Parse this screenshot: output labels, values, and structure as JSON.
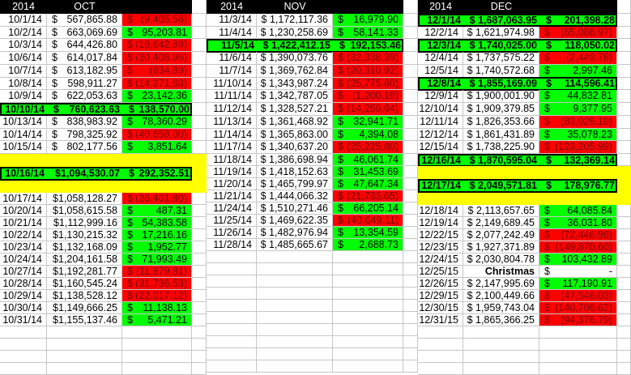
{
  "blocks": [
    {
      "header": {
        "year": "2014",
        "month": "OCT"
      },
      "rows": [
        {
          "date": "10/1/14",
          "amount_symbol": "$",
          "amount": "567,865.88",
          "change_symbol": "$",
          "change": "(9,405.56)",
          "sign": "neg"
        },
        {
          "date": "10/2/14",
          "amount_symbol": "$",
          "amount": "663,069.69",
          "change_symbol": "$",
          "change": "95,203.81",
          "sign": "pos"
        },
        {
          "date": "10/3/14",
          "amount_symbol": "$",
          "amount": "644,426.80",
          "change_symbol": "$",
          "change": "(18,642.89)",
          "sign": "neg"
        },
        {
          "date": "10/6/14",
          "amount_symbol": "$",
          "amount": "614,017.84",
          "change_symbol": "$",
          "change": "(30,408.96)",
          "sign": "neg"
        },
        {
          "date": "10/7/14",
          "amount_symbol": "$",
          "amount": "613,182.95",
          "change_symbol": "$",
          "change": "(834.89)",
          "sign": "neg"
        },
        {
          "date": "10/8/14",
          "amount_symbol": "$",
          "amount": "598,911.27",
          "change_symbol": "$",
          "change": "(14,271.68)",
          "sign": "neg"
        },
        {
          "date": "10/9/14",
          "amount_symbol": "$",
          "amount": "622,053.63",
          "change_symbol": "$",
          "change": "23,142.36",
          "sign": "pos"
        },
        {
          "date": "10/10/14",
          "amount_symbol": "$",
          "amount": "760,623.63",
          "change_symbol": "$",
          "change": "138,570.00",
          "sign": "pos",
          "emphasis": "box"
        },
        {
          "date": "10/13/14",
          "amount_symbol": "$",
          "amount": "838,983.92",
          "change_symbol": "$",
          "change": "78,360.29",
          "sign": "pos"
        },
        {
          "date": "10/14/14",
          "amount_symbol": "$",
          "amount": "798,325.92",
          "change_symbol": "$",
          "change": "(40,658.00)",
          "sign": "neg"
        },
        {
          "date": "10/15/14",
          "amount_symbol": "$",
          "amount": "802,177.56",
          "change_symbol": "$",
          "change": "3,851.64",
          "sign": "pos"
        },
        {
          "date": "10/16/14",
          "amount": "$1,094,530.07",
          "change_symbol": "$",
          "change": "292,352.51",
          "sign": "pos",
          "emphasis": "band"
        },
        {
          "date": "10/17/14",
          "amount": "$1,058,128.27",
          "change_symbol": "$",
          "change": "(36,401.80)",
          "sign": "neg"
        },
        {
          "date": "10/20/14",
          "amount": "$1,058,615.58",
          "change_symbol": "$",
          "change": "487.31",
          "sign": "pos"
        },
        {
          "date": "10/21/14",
          "amount": "$1,112,999.16",
          "change_symbol": "$",
          "change": "54,383.58",
          "sign": "pos"
        },
        {
          "date": "10/22/14",
          "amount": "$1,130,215.32",
          "change_symbol": "$",
          "change": "17,216.16",
          "sign": "pos"
        },
        {
          "date": "10/23/14",
          "amount": "$1,132,168.09",
          "change_symbol": "$",
          "change": "1,952.77",
          "sign": "pos"
        },
        {
          "date": "10/24/14",
          "amount": "$1,204,161.58",
          "change_symbol": "$",
          "change": "71,993.49",
          "sign": "pos"
        },
        {
          "date": "10/27/14",
          "amount": "$1,192,281.77",
          "change_symbol": "$",
          "change": "(11,879.81)",
          "sign": "neg"
        },
        {
          "date": "10/28/14",
          "amount": "$1,160,545.24",
          "change_symbol": "$",
          "change": "(31,736.53)",
          "sign": "neg"
        },
        {
          "date": "10/29/14",
          "amount": "$1,138,528.12",
          "change_symbol": "$",
          "change": "(22,017.12)",
          "sign": "neg"
        },
        {
          "date": "10/30/14",
          "amount": "$1,149,666.25",
          "change_symbol": "$",
          "change": "11,138.13",
          "sign": "pos"
        },
        {
          "date": "10/31/14",
          "amount": "$1,155,137.46",
          "change_symbol": "$",
          "change": "5,471.21",
          "sign": "pos"
        }
      ]
    },
    {
      "header": {
        "year": "2014",
        "month": "NOV"
      },
      "rows": [
        {
          "date": "11/3/14",
          "amount": "$ 1,172,117.36",
          "change_symbol": "$",
          "change": "16,979.90",
          "sign": "pos"
        },
        {
          "date": "11/4/14",
          "amount": "$ 1,230,258.69",
          "change_symbol": "$",
          "change": "58,141.33",
          "sign": "pos"
        },
        {
          "date": "11/5/14",
          "amount": "$ 1,422,412.15",
          "change_symbol": "$",
          "change": "192,153.46",
          "sign": "pos",
          "emphasis": "box"
        },
        {
          "date": "11/6/14",
          "amount": "$ 1,390,073.76",
          "change_symbol": "$",
          "change": "(32,338.39)",
          "sign": "neg"
        },
        {
          "date": "11/7/14",
          "amount": "$ 1,369,762.84",
          "change_symbol": "$",
          "change": "(20,310.92)",
          "sign": "neg"
        },
        {
          "date": "11/10/14",
          "amount": "$ 1,343,987.24",
          "change_symbol": "$",
          "change": "(25,775.60)",
          "sign": "neg"
        },
        {
          "date": "11/11/14",
          "amount": "$ 1,342,787.05",
          "change_symbol": "$",
          "change": "(1,200.19)",
          "sign": "neg"
        },
        {
          "date": "11/12/14",
          "amount": "$ 1,328,527.21",
          "change_symbol": "$",
          "change": "(14,259.84)",
          "sign": "neg"
        },
        {
          "date": "11/13/14",
          "amount": "$ 1,361,468.92",
          "change_symbol": "$",
          "change": "32,941.71",
          "sign": "pos"
        },
        {
          "date": "11/14/14",
          "amount": "$ 1,365,863.00",
          "change_symbol": "$",
          "change": "4,394.08",
          "sign": "pos"
        },
        {
          "date": "11/17/14",
          "amount": "$ 1,340,637.20",
          "change_symbol": "$",
          "change": "(25,225.80)",
          "sign": "neg"
        },
        {
          "date": "11/18/14",
          "amount": "$ 1,386,698.94",
          "change_symbol": "$",
          "change": "46,061.74",
          "sign": "pos"
        },
        {
          "date": "11/19/14",
          "amount": "$ 1,418,152.63",
          "change_symbol": "$",
          "change": "31,453.69",
          "sign": "pos"
        },
        {
          "date": "11/20/14",
          "amount": "$ 1,465,799.97",
          "change_symbol": "$",
          "change": "47,647.34",
          "sign": "pos"
        },
        {
          "date": "11/21/14",
          "amount": "$ 1,444,066.32",
          "change_symbol": "$",
          "change": "(21,733.65)",
          "sign": "neg"
        },
        {
          "date": "11/24/14",
          "amount": "$ 1,510,271.46",
          "change_symbol": "$",
          "change": "66,205.14",
          "sign": "pos"
        },
        {
          "date": "11/25/14",
          "amount": "$ 1,469,622.35",
          "change_symbol": "$",
          "change": "(40,649.11)",
          "sign": "neg"
        },
        {
          "date": "11/26/14",
          "amount": "$ 1,482,976.94",
          "change_symbol": "$",
          "change": "13,354.59",
          "sign": "pos"
        },
        {
          "date": "11/28/14",
          "amount": "$ 1,485,665.67",
          "change_symbol": "$",
          "change": "2,688.73",
          "sign": "pos"
        }
      ]
    },
    {
      "header": {
        "year": "2014",
        "month": "DEC"
      },
      "rows": [
        {
          "date": "12/1/14",
          "amount": "$ 1,687,063.95",
          "change_symbol": "$",
          "change": "201,398.28",
          "sign": "pos",
          "emphasis": "box"
        },
        {
          "date": "12/2/14",
          "amount": "$ 1,621,974.98",
          "change_symbol": "$",
          "change": "(65,088.97)",
          "sign": "neg"
        },
        {
          "date": "12/3/14",
          "amount": "$ 1,740,025.00",
          "change_symbol": "$",
          "change": "118,050.02",
          "sign": "pos",
          "emphasis": "box"
        },
        {
          "date": "12/4/14",
          "amount": "$ 1,737,575.22",
          "change_symbol": "$",
          "change": "(2,449.78)",
          "sign": "neg"
        },
        {
          "date": "12/5/14",
          "amount": "$ 1,740,572.68",
          "change_symbol": "$",
          "change": "2,997.46",
          "sign": "pos"
        },
        {
          "date": "12/8/14",
          "amount": "$ 1,855,169.09",
          "change_symbol": "$",
          "change": "114,596.41",
          "sign": "pos",
          "emphasis": "box"
        },
        {
          "date": "12/9/14",
          "amount": "$ 1,900,001.90",
          "change_symbol": "$",
          "change": "44,832.81",
          "sign": "pos"
        },
        {
          "date": "12/10/14",
          "amount": "$ 1,909,379.85",
          "change_symbol": "$",
          "change": "9,377.95",
          "sign": "pos"
        },
        {
          "date": "12/11/14",
          "amount": "$ 1,826,353.66",
          "change_symbol": "$",
          "change": "(83,026.19)",
          "sign": "neg"
        },
        {
          "date": "12/12/14",
          "amount": "$ 1,861,431.89",
          "change_symbol": "$",
          "change": "35,078.23",
          "sign": "pos"
        },
        {
          "date": "12/15/14",
          "amount": "$ 1,738,225.90",
          "change_symbol": "$",
          "change": "(123,205.99)",
          "sign": "neg"
        },
        {
          "date": "12/16/14",
          "amount": "$ 1,870,595.04",
          "change_symbol": "$",
          "change": "132,369.14",
          "sign": "pos",
          "emphasis": "box"
        },
        {
          "date": "12/17/14",
          "amount": "$ 2,049,571.81",
          "change_symbol": "$",
          "change": "178,976.77",
          "sign": "pos",
          "emphasis": "band"
        },
        {
          "date": "12/18/14",
          "amount": "$ 2,113,657.65",
          "change_symbol": "$",
          "change": "64,085.84",
          "sign": "pos"
        },
        {
          "date": "12/19/14",
          "amount": "$ 2,149,689.45",
          "change_symbol": "$",
          "change": "36,031.80",
          "sign": "pos"
        },
        {
          "date": "12/22/15",
          "amount": "$ 2,077,242.49",
          "change_symbol": "$",
          "change": "(72,446.96)",
          "sign": "neg"
        },
        {
          "date": "12/23/15",
          "amount": "$ 1,927,371.89",
          "change_symbol": "$",
          "change": "(149,870.60)",
          "sign": "neg"
        },
        {
          "date": "12/24/15",
          "amount": "$ 2,030,804.78",
          "change_symbol": "$",
          "change": "103,432.89",
          "sign": "pos"
        },
        {
          "date": "12/25/15",
          "amount": "Christmas",
          "change_symbol": "$",
          "change": "-",
          "sign": "none",
          "holiday": true
        },
        {
          "date": "12/26/15",
          "amount": "$ 2,147,995.69",
          "change_symbol": "$",
          "change": "117,190.91",
          "sign": "pos"
        },
        {
          "date": "12/29/15",
          "amount": "$ 2,100,449.66",
          "change_symbol": "$",
          "change": "(47,546.03)",
          "sign": "neg"
        },
        {
          "date": "12/30/15",
          "amount": "$ 1,959,743.04",
          "change_symbol": "$",
          "change": "(140,706.62)",
          "sign": "neg"
        },
        {
          "date": "12/31/15",
          "amount": "$ 1,865,366.25",
          "change_symbol": "$",
          "change": "(94,376.79)",
          "sign": "neg"
        }
      ]
    }
  ],
  "colors": {
    "positive": "#00ff00",
    "negative": "#ff0000",
    "highlight_band": "#ffff00",
    "header": "#000000"
  }
}
